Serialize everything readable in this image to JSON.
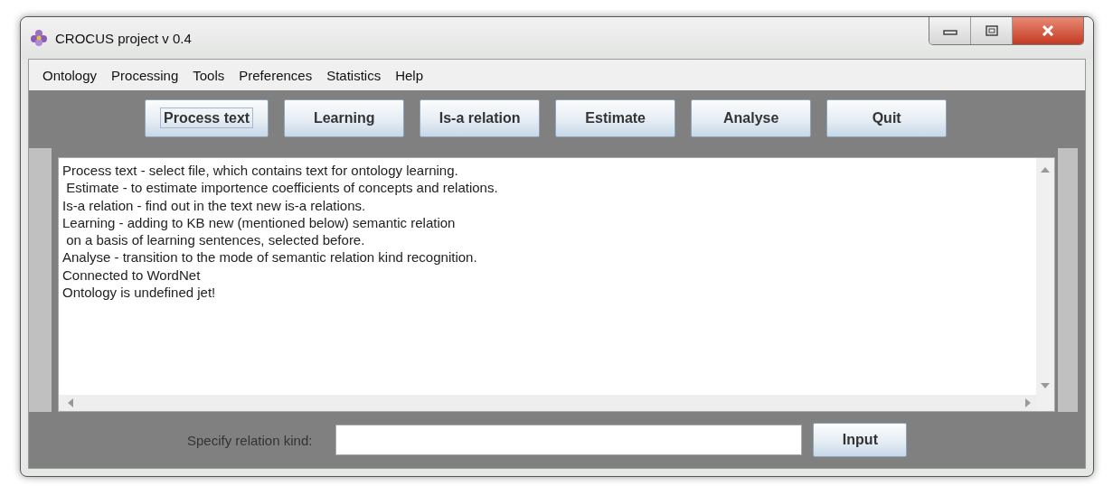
{
  "window": {
    "title": "CROCUS project v 0.4"
  },
  "menu": [
    "Ontology",
    "Processing",
    "Tools",
    "Preferences",
    "Statistics",
    "Help"
  ],
  "toolbar": [
    {
      "label": "Process text",
      "focused": true
    },
    {
      "label": "Learning",
      "focused": false
    },
    {
      "label": "Is-a relation",
      "focused": false
    },
    {
      "label": "Estimate",
      "focused": false
    },
    {
      "label": "Analyse",
      "focused": false
    },
    {
      "label": "Quit",
      "focused": false
    }
  ],
  "log": [
    "Process text - select file, which contains text for ontology learning.",
    " Estimate - to estimate importence coefficients of concepts and relations.",
    "Is-a relation - find out in the text new is-a relations.",
    "Learning - adding to KB new (mentioned below) semantic relation",
    " on a basis of learning sentences, selected before.",
    "Analyse - transition to the mode of semantic relation kind recognition.",
    "Connected to WordNet",
    "Ontology is undefined jet!"
  ],
  "input": {
    "label": "Specify relation kind:",
    "button": "Input"
  }
}
